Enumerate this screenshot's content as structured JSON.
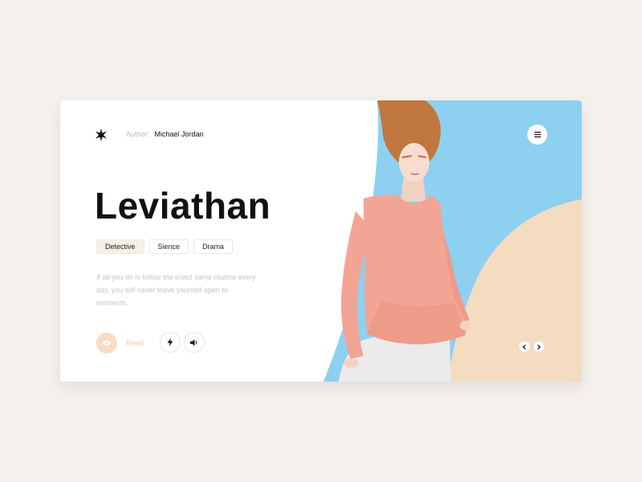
{
  "header": {
    "author_label": "Author:",
    "author_name": "Michael Jordan"
  },
  "book": {
    "title": "Leviathan",
    "genres": [
      "Detective",
      "Sience",
      "Drama"
    ],
    "description": "If all you do is follow the exact same routine every day, you will never leave yourself open to moments."
  },
  "actions": {
    "read_label": "Read",
    "read_icon": "eye-icon",
    "flash_icon": "lightning-icon",
    "audio_icon": "speaker-icon"
  },
  "navigation": {
    "menu_icon": "menu-icon",
    "prev_icon": "chevron-left-icon",
    "next_icon": "chevron-right-icon"
  },
  "colors": {
    "background": "#f4f1ec",
    "card": "#ffffff",
    "sky_blue": "#8ed0f0",
    "peach": "#f4dcc1",
    "dress_pink": "#f2a595",
    "hair": "#c0773f",
    "read_accent": "#f8dcc6",
    "text_dark": "#111111",
    "text_muted": "#c4c4c4"
  }
}
